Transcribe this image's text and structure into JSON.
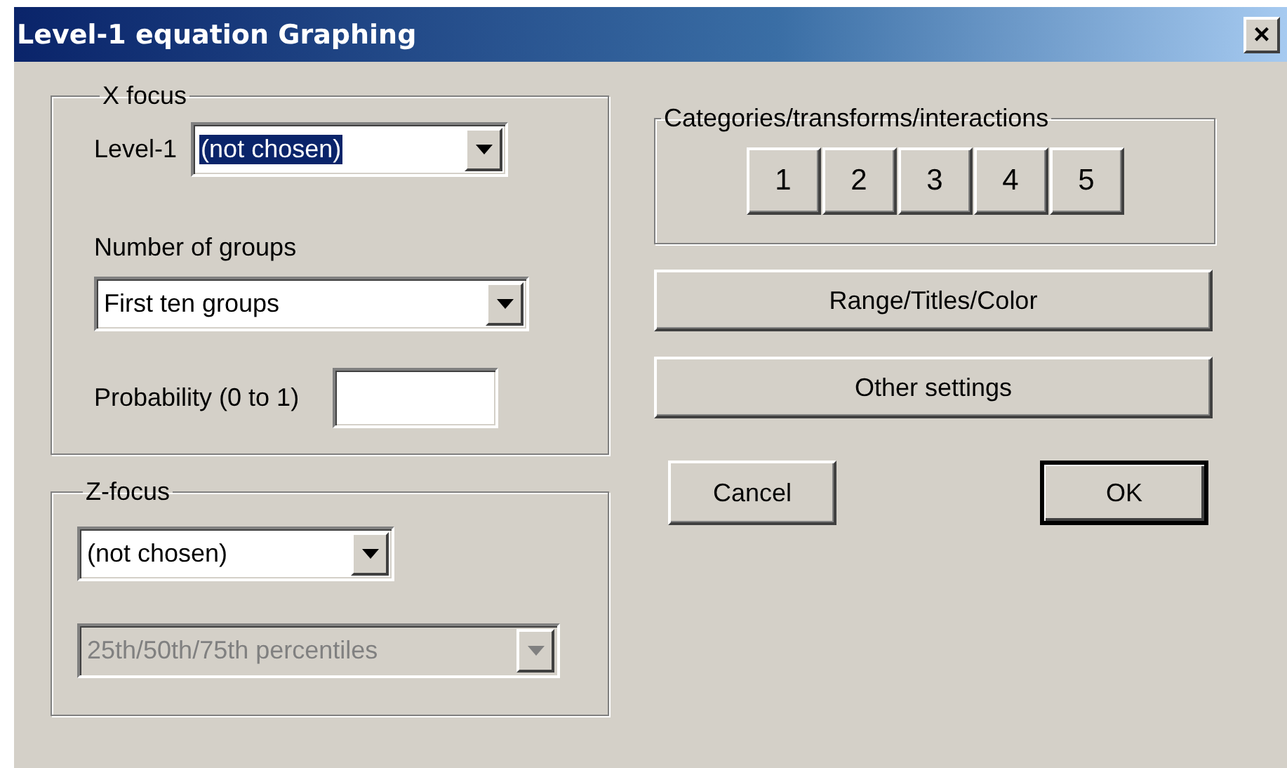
{
  "window": {
    "title": "Level-1 equation Graphing",
    "close": "×"
  },
  "x_focus": {
    "legend": "X focus",
    "level1": {
      "label": "Level-1",
      "value": "(not chosen)",
      "highlighted": true,
      "disabled": false
    },
    "groups_label": "Number of groups",
    "groups": {
      "value": "First ten groups",
      "highlighted": false,
      "disabled": false
    },
    "probability": {
      "label": "Probability (0 to 1)"
    }
  },
  "z_focus": {
    "legend": "Z-focus",
    "variable": {
      "value": "(not chosen)",
      "highlighted": false,
      "disabled": false
    },
    "percentiles": {
      "value": "25th/50th/75th percentiles",
      "highlighted": false,
      "disabled": true
    }
  },
  "categories": {
    "legend": "Categories/transforms/interactions",
    "buttons": [
      "1",
      "2",
      "3",
      "4",
      "5"
    ]
  },
  "buttons": [
    {
      "label": "Range/Titles/Color",
      "kind": "wide",
      "default": false
    },
    {
      "label": "Other settings",
      "kind": "wide",
      "default": false
    },
    {
      "label": "Cancel",
      "kind": "action",
      "default": false
    },
    {
      "label": "OK",
      "kind": "action",
      "default": true
    }
  ]
}
